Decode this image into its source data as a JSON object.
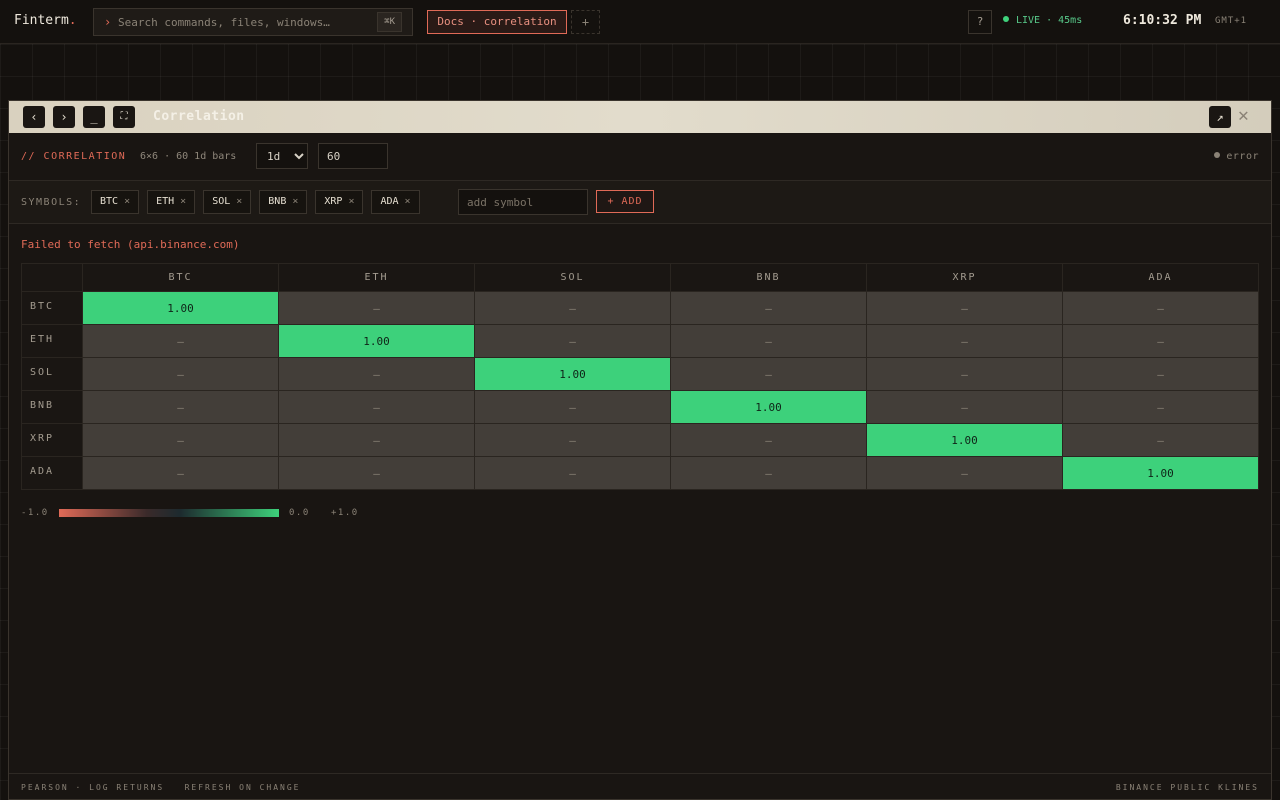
{
  "app": {
    "brand": "Finterm",
    "brand_dot": ".",
    "search_placeholder": "Search commands, files, windows…",
    "search_shortcut": "⌘K",
    "active_tab": "Docs · correlation",
    "add_tab": "+",
    "help": "?",
    "live_status": "LIVE · 45ms",
    "clock": "6:10:32 PM",
    "timezone": "GMT+1"
  },
  "window": {
    "title": "Correlation",
    "nav_back": "‹",
    "nav_forward": "›",
    "minimize": "_",
    "maximize": "⛶",
    "popout": "↗",
    "close": "✕"
  },
  "toolbar": {
    "label": "// CORRELATION",
    "info": "6×6 · 60 1d bars",
    "interval": "1d",
    "interval_options": [
      "1d"
    ],
    "bars": "60",
    "status": "error"
  },
  "symbols": {
    "label": "SYMBOLS:",
    "chips": [
      {
        "name": "BTC",
        "remove": "×"
      },
      {
        "name": "ETH",
        "remove": "×"
      },
      {
        "name": "SOL",
        "remove": "×"
      },
      {
        "name": "BNB",
        "remove": "×"
      },
      {
        "name": "XRP",
        "remove": "×"
      },
      {
        "name": "ADA",
        "remove": "×"
      }
    ],
    "add_placeholder": "add symbol",
    "add_button": "+ ADD"
  },
  "error_message": "Failed to fetch (api.binance.com)",
  "matrix": {
    "columns": [
      "BTC",
      "ETH",
      "SOL",
      "BNB",
      "XRP",
      "ADA"
    ],
    "rows": [
      {
        "label": "BTC",
        "cells": [
          "1.00",
          "—",
          "—",
          "—",
          "—",
          "—"
        ]
      },
      {
        "label": "ETH",
        "cells": [
          "—",
          "1.00",
          "—",
          "—",
          "—",
          "—"
        ]
      },
      {
        "label": "SOL",
        "cells": [
          "—",
          "—",
          "1.00",
          "—",
          "—",
          "—"
        ]
      },
      {
        "label": "BNB",
        "cells": [
          "—",
          "—",
          "—",
          "1.00",
          "—",
          "—"
        ]
      },
      {
        "label": "XRP",
        "cells": [
          "—",
          "—",
          "—",
          "—",
          "1.00",
          "—"
        ]
      },
      {
        "label": "ADA",
        "cells": [
          "—",
          "—",
          "—",
          "—",
          "—",
          "1.00"
        ]
      }
    ]
  },
  "legend": {
    "min": "-1.0",
    "mid": "0.0",
    "max": "+1.0",
    "colors": {
      "negative": "#e06a57",
      "neutral": "#1d2a2e",
      "positive": "#3dd17b"
    }
  },
  "footer": {
    "left": "PEARSON · LOG RETURNS   REFRESH ON CHANGE",
    "right": "BINANCE PUBLIC KLINES"
  }
}
